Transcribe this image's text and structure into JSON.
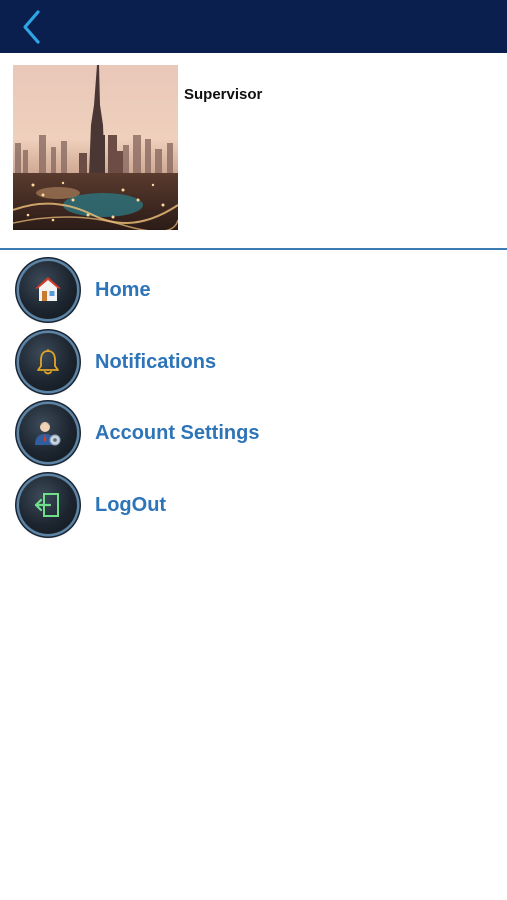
{
  "header": {
    "back_icon": "chevron-left-icon",
    "background_color": "#0b1f4f",
    "accent_color": "#2ea6e6"
  },
  "profile": {
    "role": "Supervisor",
    "photo_description_icon": "city-skyline-photo"
  },
  "menu": {
    "label_color": "#2e74b8",
    "items": [
      {
        "label": "Home",
        "icon": "house-icon"
      },
      {
        "label": "Notifications",
        "icon": "bell-icon"
      },
      {
        "label": "Account Settings",
        "icon": "user-gear-icon"
      },
      {
        "label": "LogOut",
        "icon": "logout-door-icon"
      }
    ]
  }
}
